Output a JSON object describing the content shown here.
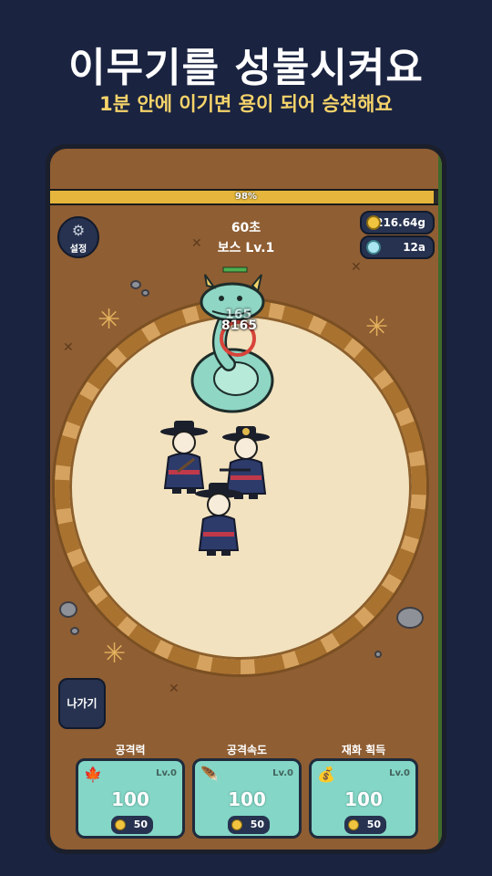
{
  "promo": {
    "headline": "이무기를 성불시켜요",
    "subline": "1분 안에 이기면 용이 되어 승천해요"
  },
  "hud": {
    "hp_percent_text": "98%",
    "hp_fraction": 0.98,
    "timer": "60초",
    "boss_label": "보스 Lv.1",
    "settings_label": "설정",
    "gold": "216.64g",
    "gems": "12a"
  },
  "combat": {
    "damage_numbers": [
      "165",
      "8165"
    ]
  },
  "controls": {
    "exit_label": "나가기"
  },
  "upgrades": [
    {
      "title": "공격력",
      "icon": "maple-leaf-icon",
      "level": "Lv.0",
      "value": "100",
      "cost": "50"
    },
    {
      "title": "공격속도",
      "icon": "feather-icon",
      "level": "Lv.0",
      "value": "100",
      "cost": "50"
    },
    {
      "title": "재화 획득",
      "icon": "money-bag-icon",
      "level": "Lv.0",
      "value": "100",
      "cost": "50"
    }
  ],
  "colors": {
    "background": "#1a2340",
    "accent": "#f5d36a",
    "hp_bar": "#e5b63b",
    "card": "#84d6c6",
    "dragon": "#8fd6c4"
  }
}
